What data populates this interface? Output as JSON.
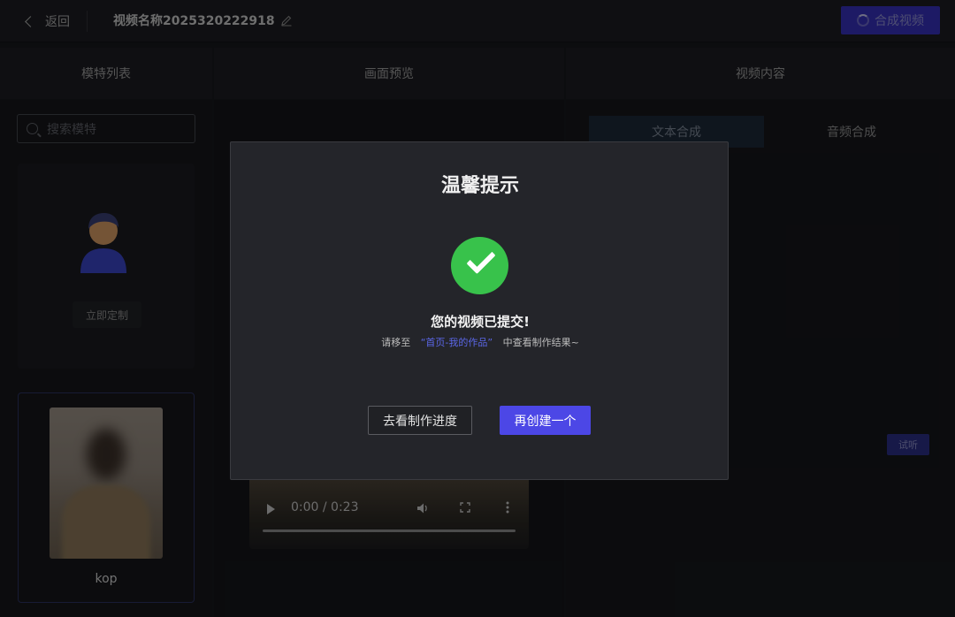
{
  "topbar": {
    "back_label": "返回",
    "video_name": "视频名称2025320222918",
    "compose_label": "合成视频"
  },
  "panels": {
    "models_title": "模特列表",
    "preview_title": "画面预览",
    "content_title": "视频内容"
  },
  "models": {
    "search_placeholder": "搜索模特",
    "custom_label": "立即定制",
    "items": [
      {
        "name": "kop"
      }
    ]
  },
  "preview": {
    "time": "0:00 / 0:23"
  },
  "content": {
    "tabs": [
      {
        "label": "文本合成",
        "active": true
      },
      {
        "label": "音频合成",
        "active": false
      }
    ],
    "listen_label": "试听"
  },
  "modal": {
    "title": "温馨提示",
    "message": "您的视频已提交!",
    "sub_prefix": "请移至",
    "sub_link": "“首页-我的作品”",
    "sub_suffix": "中查看制作结果~",
    "secondary_label": "去看制作进度",
    "primary_label": "再创建一个"
  },
  "colors": {
    "accent": "#4c47e6",
    "success": "#38c24b",
    "link": "#5b67e8"
  }
}
